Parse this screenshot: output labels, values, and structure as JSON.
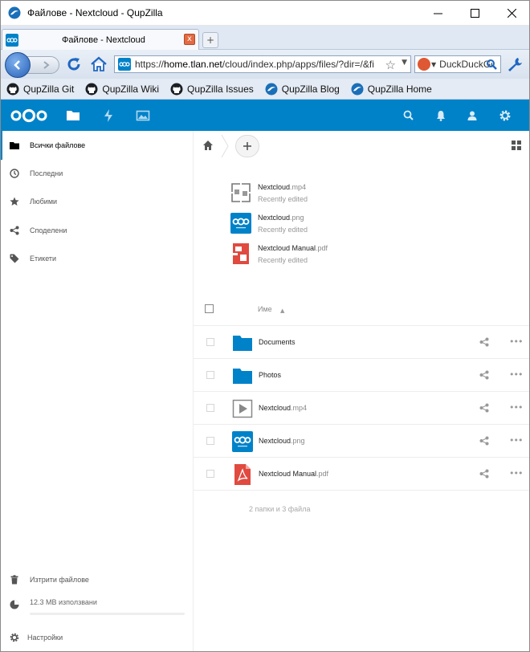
{
  "window": {
    "title": "Файлове - Nextcloud - QupZilla"
  },
  "tab": {
    "title": "Файлове - Nextcloud",
    "close_label": "x",
    "newtab_label": "+"
  },
  "nav": {
    "url_prefix": "https://",
    "url_host": "home.tlan.net",
    "url_path": "/cloud/index.php/apps/files/?dir=/&fileid=",
    "search_text": "DuckDuckGo"
  },
  "bookmarks": [
    {
      "label": "QupZilla Git",
      "icon": "github-icon"
    },
    {
      "label": "QupZilla Wiki",
      "icon": "github-icon"
    },
    {
      "label": "QupZilla Issues",
      "icon": "github-icon"
    },
    {
      "label": "QupZilla Blog",
      "icon": "qupzilla-icon"
    },
    {
      "label": "QupZilla Home",
      "icon": "qupzilla-icon"
    }
  ],
  "sidebar": {
    "items": [
      {
        "label": "Всички файлове",
        "icon": "folder-icon"
      },
      {
        "label": "Последни",
        "icon": "clock-icon"
      },
      {
        "label": "Любими",
        "icon": "star-icon"
      },
      {
        "label": "Споделени",
        "icon": "share-icon"
      },
      {
        "label": "Етикети",
        "icon": "tag-icon"
      }
    ],
    "deleted_label": "Изтрити файлове",
    "quota_label": "12.3 MB използвани",
    "quota_fraction": 0.0,
    "settings_label": "Настройки"
  },
  "recent": [
    {
      "name": "Nextcloud",
      "ext": ".mp4",
      "sub": "Recently edited",
      "icon": "video-icon"
    },
    {
      "name": "Nextcloud",
      "ext": ".png",
      "sub": "Recently edited",
      "icon": "nextcloud-image-icon"
    },
    {
      "name": "Nextcloud Manual",
      "ext": ".pdf",
      "sub": "Recently edited",
      "icon": "pdf-icon"
    }
  ],
  "table": {
    "name_header": "Име"
  },
  "files": [
    {
      "name": "Documents",
      "ext": "",
      "icon": "folder-icon"
    },
    {
      "name": "Photos",
      "ext": "",
      "icon": "folder-icon"
    },
    {
      "name": "Nextcloud",
      "ext": ".mp4",
      "icon": "video-icon"
    },
    {
      "name": "Nextcloud",
      "ext": ".png",
      "icon": "nextcloud-image-icon"
    },
    {
      "name": "Nextcloud Manual",
      "ext": ".pdf",
      "icon": "pdf-icon"
    }
  ],
  "summary": "2 папки и 3 файла",
  "colors": {
    "nextcloud_blue": "#0082c9",
    "pdf_red": "#e04a3f"
  }
}
